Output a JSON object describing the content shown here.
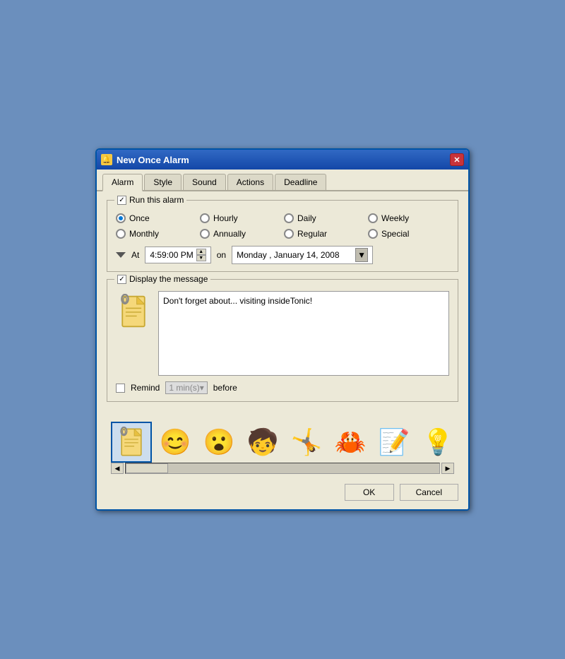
{
  "window": {
    "title": "New Once Alarm",
    "icon": "🔔"
  },
  "tabs": [
    {
      "label": "Alarm",
      "active": true
    },
    {
      "label": "Style",
      "active": false
    },
    {
      "label": "Sound",
      "active": false
    },
    {
      "label": "Actions",
      "active": false
    },
    {
      "label": "Deadline",
      "active": false
    }
  ],
  "alarm_section": {
    "label": "Run this alarm",
    "checked": true
  },
  "recurrence": {
    "options": [
      {
        "label": "Once",
        "selected": true
      },
      {
        "label": "Hourly",
        "selected": false
      },
      {
        "label": "Daily",
        "selected": false
      },
      {
        "label": "Weekly",
        "selected": false
      },
      {
        "label": "Monthly",
        "selected": false
      },
      {
        "label": "Annually",
        "selected": false
      },
      {
        "label": "Regular",
        "selected": false
      },
      {
        "label": "Special",
        "selected": false
      }
    ]
  },
  "time": {
    "at_label": "At",
    "time_value": "4:59:00 PM",
    "on_label": "on",
    "date_value": "Monday  ,  January  14, 2008"
  },
  "message_section": {
    "label": "Display the message",
    "checked": true,
    "message": "Don't forget about... visiting insideTonic!"
  },
  "remind": {
    "label": "Remind",
    "checked": false,
    "mins_label": "1 min(s)▾",
    "before_label": "before"
  },
  "buttons": {
    "ok": "OK",
    "cancel": "Cancel"
  },
  "icons": [
    "📋",
    "😊",
    "😮",
    "👦",
    "🤸",
    "🦀",
    "📝",
    "💡"
  ]
}
